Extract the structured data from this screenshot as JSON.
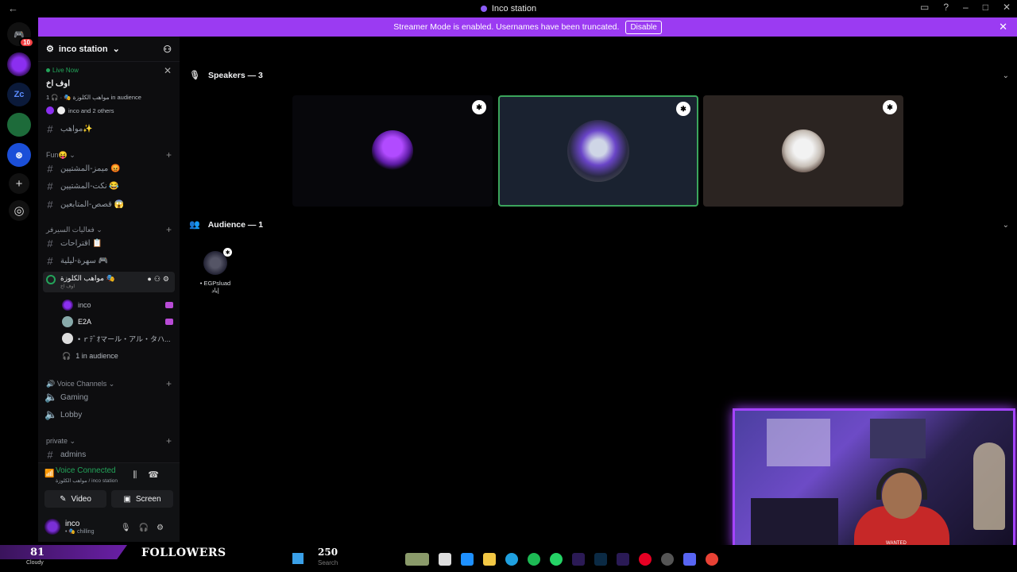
{
  "window": {
    "title": "Inco station"
  },
  "banner": {
    "text": "Streamer Mode is enabled. Usernames have been truncated.",
    "button": "Disable"
  },
  "rail": {
    "badge": "10",
    "zc_label": "Zc"
  },
  "server": {
    "name": "inco station"
  },
  "live": {
    "status": "Live Now",
    "title": "اوف اخ",
    "subtitle": "مواهب الكلوزة 🎭 · 🎧 1 in audience",
    "others": "inco and 2 others"
  },
  "channels": {
    "top": "مواهب✨",
    "fun_category": "Fun😝",
    "fun": [
      "ميمز-المشتيين 😡",
      "نكت-المشتيين 😂",
      "قصص-المتابعين 😱"
    ],
    "events_category": "فعاليات السيرفر",
    "events": [
      "اقتراحات 📋",
      "سهرة-ليلية 🎮"
    ],
    "stage_name": "مواهب الكلوزة 🎭",
    "stage_sub": "اوف اخ",
    "members": [
      "inco",
      "E2A",
      "• ｒﾃﾞｵマール・アル・タハ..."
    ],
    "audience": "1 in audience",
    "voice_category": "Voice Channels",
    "voice": [
      "Gaming",
      "Lobby"
    ],
    "private_category": "private",
    "private": [
      "admins"
    ]
  },
  "voice_panel": {
    "status": "Voice Connected",
    "location": "مواهب الكلوزة / inco station",
    "video": "Video",
    "screen": "Screen",
    "user": "inco",
    "user_status": "• 🎭 chilling"
  },
  "stage": {
    "speakers": "Speakers — 3",
    "audience": "Audience — 1",
    "audience_member": "• EGPsluad إياد"
  },
  "overlay": {
    "count": "81",
    "weather": "Cloudy",
    "label": "FOLLOWERS",
    "goal": "250",
    "search": "Search"
  },
  "cam": {
    "tag": "WANTED"
  },
  "colors": {
    "accent": "#9b3bf2",
    "green": "#23a55a",
    "speaker_ring": "#3ba55c"
  }
}
